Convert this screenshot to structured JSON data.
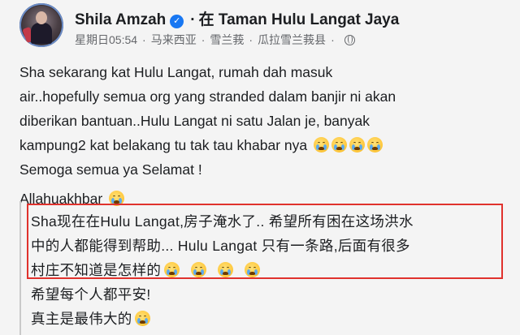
{
  "author": {
    "name": "Shila Amzah",
    "verified_icon": "verified-badge-icon",
    "location_prefix": "在",
    "location": "Taman Hulu Langat Jaya"
  },
  "meta": {
    "day": "星期日",
    "time": "05:54",
    "region_parts": [
      "马来西亚",
      "雪兰莪",
      "瓜拉雪兰莪县"
    ],
    "audience_icon": "globe-icon"
  },
  "post": {
    "lines": [
      "Sha sekarang kat Hulu Langat, rumah dah masuk",
      "air..hopefully semua org yang stranded dalam banjir ni akan",
      "diberikan bantuan..Hulu Langat ni satu Jalan je, banyak",
      "kampung2 kat belakang tu tak tau khabar nya",
      "Semoga semua ya Selamat !",
      "Allahuakhbar"
    ],
    "emoji_name": "loudly-crying-face-emoji"
  },
  "translation": {
    "lines": [
      "Sha现在在Hulu Langat,房子淹水了.. 希望所有困在这场洪水",
      "中的人都能得到帮助... Hulu Langat 只有一条路,后面有很多",
      "村庄不知道是怎样的",
      "希望每个人都平安!",
      "真主是最伟大的"
    ]
  },
  "colors": {
    "highlight_box": "#e0322d",
    "verified": "#1877f2",
    "meta_text": "#65676b",
    "background": "#f4f4f4"
  }
}
